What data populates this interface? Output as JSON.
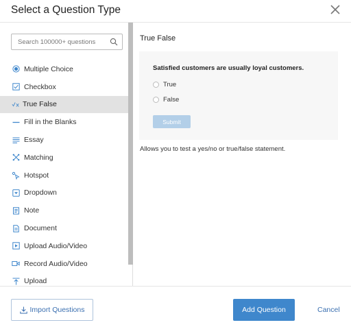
{
  "dialog": {
    "title": "Select a Question Type"
  },
  "sidebar": {
    "search_placeholder": "Search 100000+ questions",
    "items": [
      {
        "label": "Multiple Choice",
        "icon": "radio-icon"
      },
      {
        "label": "Checkbox",
        "icon": "checkbox-icon"
      },
      {
        "label": "True False",
        "icon": "true-false-icon",
        "selected": true
      },
      {
        "label": "Fill in the Blanks",
        "icon": "fill-blank-icon"
      },
      {
        "label": "Essay",
        "icon": "essay-icon"
      },
      {
        "label": "Matching",
        "icon": "matching-icon"
      },
      {
        "label": "Hotspot",
        "icon": "hotspot-icon"
      },
      {
        "label": "Dropdown",
        "icon": "dropdown-icon"
      },
      {
        "label": "Note",
        "icon": "note-icon"
      },
      {
        "label": "Document",
        "icon": "document-icon"
      },
      {
        "label": "Upload Audio/Video",
        "icon": "upload-audio-video-icon"
      },
      {
        "label": "Record Audio/Video",
        "icon": "record-audio-video-icon"
      },
      {
        "label": "Upload",
        "icon": "upload-icon"
      }
    ]
  },
  "preview": {
    "title": "True False",
    "question": "Satisfied customers are usually loyal customers.",
    "options": [
      "True",
      "False"
    ],
    "submit_label": "Submit",
    "description": "Allows you to test a yes/no or true/false statement."
  },
  "footer": {
    "import_label": "Import Questions",
    "add_label": "Add Question",
    "cancel_label": "Cancel"
  },
  "colors": {
    "accent": "#3f87cc",
    "selected_bg": "#e2e2e2",
    "submit_disabled": "#b3cfe8"
  }
}
